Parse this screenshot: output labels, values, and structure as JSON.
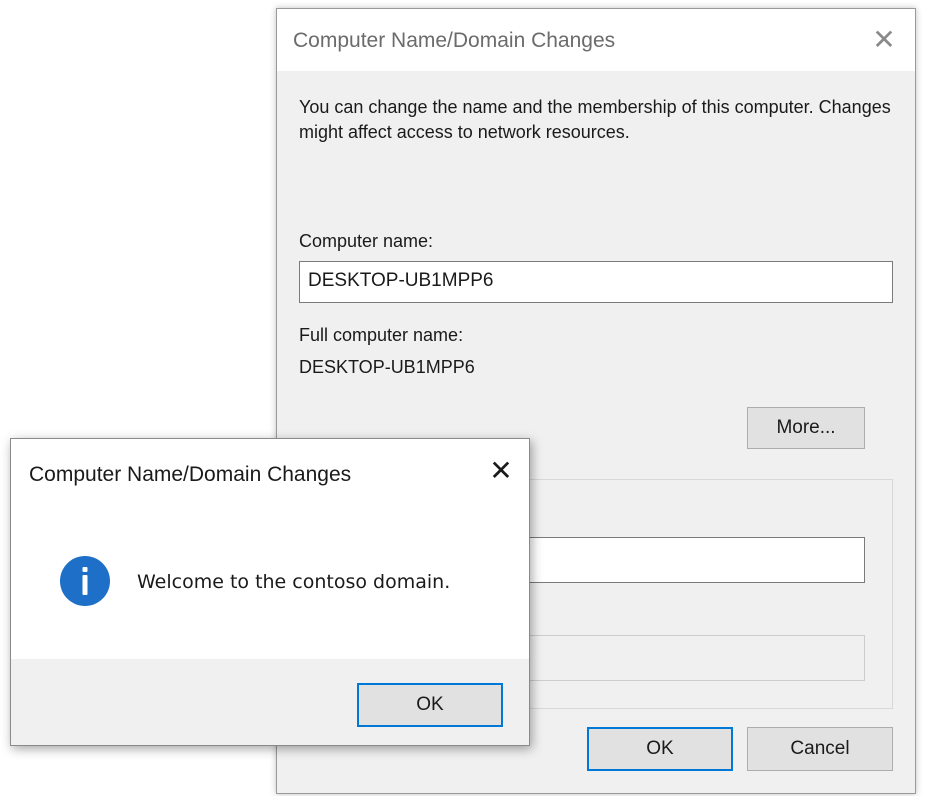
{
  "main_dialog": {
    "title": "Computer Name/Domain Changes",
    "close_glyph": "✕",
    "description": "You can change the name and the membership of this computer. Changes might affect access to network resources.",
    "computer_name_label": "Computer name:",
    "computer_name_value": "DESKTOP-UB1MPP6",
    "full_name_label": "Full computer name:",
    "full_name_value": "DESKTOP-UB1MPP6",
    "more_button": "More...",
    "ok_button": "OK",
    "cancel_button": "Cancel"
  },
  "message_box": {
    "title": "Computer Name/Domain Changes",
    "close_glyph": "✕",
    "icon": "info-icon",
    "message": "Welcome to the contoso domain.",
    "ok_button": "OK"
  },
  "colors": {
    "accent": "#0078d7",
    "info_icon": "#1e6fc7",
    "dialog_bg": "#f0f0f0"
  }
}
